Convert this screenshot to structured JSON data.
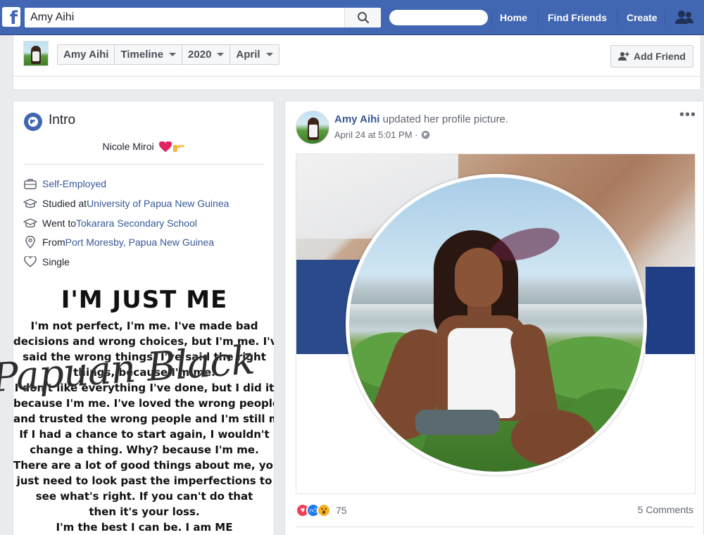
{
  "topbar": {
    "logo": "f",
    "search_value": "Amy Aihi",
    "search_placeholder": "Search",
    "nav": [
      "Home",
      "Find Friends",
      "Create"
    ],
    "color": "#4267b2"
  },
  "profile_nav": {
    "crumbs": [
      {
        "label": "Amy Aihi",
        "dropdown": false
      },
      {
        "label": "Timeline",
        "dropdown": true
      },
      {
        "label": "2020",
        "dropdown": true
      },
      {
        "label": "April",
        "dropdown": true
      }
    ],
    "add_friend": "Add Friend"
  },
  "intro": {
    "title": "Intro",
    "bio": "Nicole Miroi",
    "bio_emoji": [
      "red-heart",
      "pointing-hand"
    ],
    "items": [
      {
        "icon": "briefcase-icon",
        "prefix": "",
        "link": "Self-Employed"
      },
      {
        "icon": "graduation-cap-icon",
        "prefix": "Studied at ",
        "link": "University of Papua New Guinea"
      },
      {
        "icon": "graduation-cap-icon",
        "prefix": "Went to ",
        "link": "Tokarara Secondary School"
      },
      {
        "icon": "location-pin-icon",
        "prefix": "From ",
        "link": "Port Moresby, Papua New Guinea"
      },
      {
        "icon": "heart-outline-icon",
        "prefix": "Single",
        "link": ""
      }
    ],
    "quote_title": "I'M JUST ME",
    "quote_lines": [
      "I'm not perfect, I'm me. I've made bad",
      "decisions and wrong choices, but I'm me. I'v",
      "said the wrong things, I've said the right",
      "things, because I'm me.",
      "I don't like everything I've done, but I did it",
      "because I'm me. I've loved the wrong people",
      "and trusted the wrong people and I'm still me",
      "If I had a chance to start again, I wouldn't",
      "change a thing. Why? because I'm me.",
      "There are a lot of good things about me, you",
      "just need to look past the imperfections to",
      "see what's right. If you can't do that",
      "then it's your loss.",
      "I'm the best I can be. I am ME"
    ],
    "watermark": "Papuan Black"
  },
  "post": {
    "author": "Amy Aihi",
    "action": " updated her profile picture.",
    "time": "April 24 at 5:01 PM · ",
    "privacy_icon": "globe-icon",
    "more": "•••",
    "reaction_count": "75",
    "reactions": [
      "love",
      "like",
      "wow"
    ],
    "comments": "5 Comments"
  }
}
